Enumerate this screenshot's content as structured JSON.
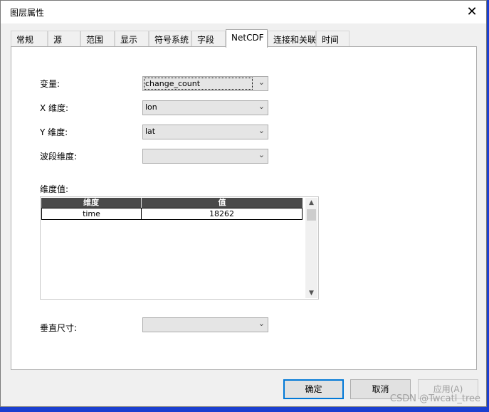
{
  "window": {
    "title": "图层属性",
    "close_glyph": "✕"
  },
  "tabs": [
    {
      "label": "常规"
    },
    {
      "label": "源"
    },
    {
      "label": "范围"
    },
    {
      "label": "显示"
    },
    {
      "label": "符号系统"
    },
    {
      "label": "字段"
    },
    {
      "label": "NetCDF",
      "active": true
    },
    {
      "label": "连接和关联"
    },
    {
      "label": "时间"
    }
  ],
  "netcdf": {
    "variable": {
      "label": "变量:",
      "value": "change_count"
    },
    "x_dimension": {
      "label": "X 维度:",
      "value": "lon"
    },
    "y_dimension": {
      "label": "Y 维度:",
      "value": "lat"
    },
    "band_dimension": {
      "label": "波段维度:",
      "value": ""
    },
    "dimension_values": {
      "label": "维度值:",
      "columns": [
        "维度",
        "值"
      ],
      "rows": [
        {
          "dimension": "time",
          "value": "18262"
        }
      ]
    },
    "vertical_dimension": {
      "label": "垂直尺寸:",
      "value": ""
    }
  },
  "buttons": {
    "ok": "确定",
    "cancel": "取消",
    "apply": "应用(A)"
  },
  "watermark": "CSDN @Twcatl_tree",
  "colors": {
    "focus_border": "#0078d7",
    "grid_header": "#4a4a4a"
  }
}
